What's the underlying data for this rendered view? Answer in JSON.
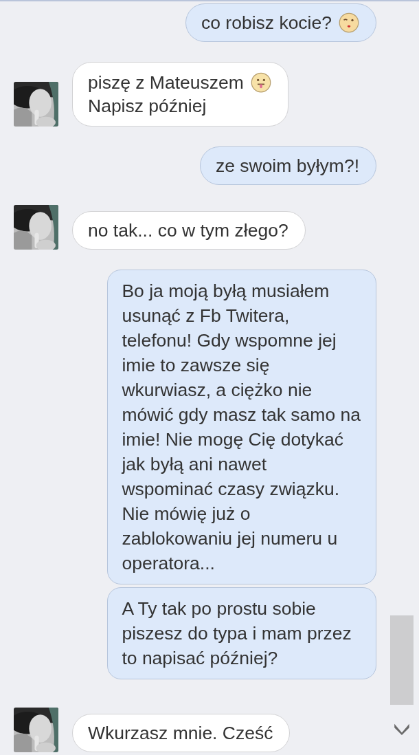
{
  "messages": [
    {
      "kind": "out",
      "bubbles": [
        {
          "lines": [
            "co robisz kocie?"
          ],
          "emoji": {
            "kind": "kiss"
          }
        }
      ]
    },
    {
      "kind": "in",
      "bubbles": [
        {
          "lines": [
            "piszę z Mateuszem",
            "Napisz później"
          ],
          "emoji": {
            "kind": "tongue"
          }
        }
      ]
    },
    {
      "kind": "out",
      "bubbles": [
        {
          "lines": [
            "ze swoim byłym?!"
          ]
        }
      ]
    },
    {
      "kind": "in",
      "bubbles": [
        {
          "lines": [
            "no tak... co w tym złego?"
          ]
        }
      ]
    },
    {
      "kind": "out",
      "bubbles": [
        {
          "lines": [
            "Bo ja moją byłą musiałem",
            "usunąć z Fb Twitera,",
            "telefonu! Gdy wspomne jej",
            "imie to zawsze się",
            "wkurwiasz, a ciężko nie",
            "mówić gdy masz tak samo na",
            "imie! Nie mogę Cię dotykać",
            "jak byłą ani nawet",
            "wspominać czasy związku.",
            "Nie mówię już o",
            "zablokowaniu jej numeru u",
            "operatora..."
          ]
        },
        {
          "lines": [
            "A Ty tak po prostu sobie",
            "piszesz do typa i mam przez",
            "to napisać później?"
          ]
        }
      ]
    },
    {
      "kind": "in",
      "bubbles": [
        {
          "lines": [
            "Wkurzasz mnie. Cześć"
          ]
        }
      ]
    }
  ]
}
